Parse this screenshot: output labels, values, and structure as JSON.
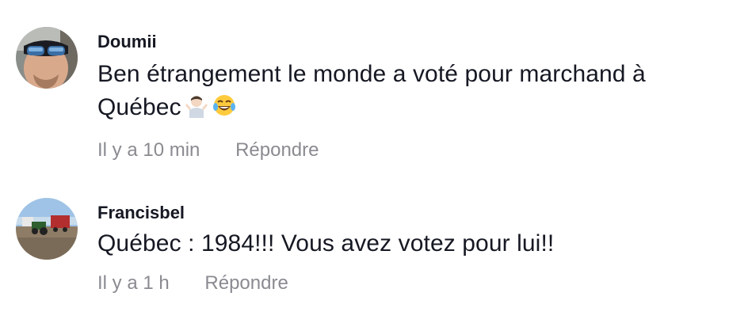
{
  "comments": [
    {
      "username": "Doumii",
      "text": "Ben étrangement le monde a voté pour marchand à Québec",
      "emojis": [
        "person-shrugging-emoji",
        "face-with-tears-of-joy-emoji"
      ],
      "time": "Il y a 10 min",
      "reply_label": "Répondre"
    },
    {
      "username": "Francisbel",
      "text": "Québec : 1984!!! Vous avez votez pour lui!!",
      "time": "Il y a 1 h",
      "reply_label": "Répondre"
    }
  ],
  "colors": {
    "text": "#161823",
    "meta": "#8a8b91",
    "background": "#ffffff"
  }
}
